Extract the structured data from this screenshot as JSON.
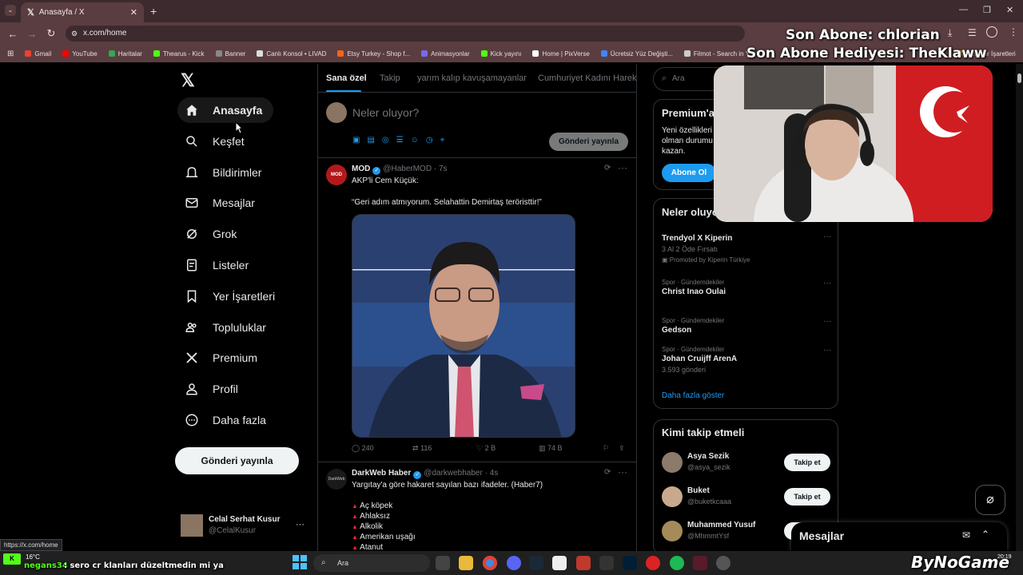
{
  "browser": {
    "tab_title": "Anasayfa / X",
    "new_tab": "+",
    "url": "x.com/home",
    "status_url": "https://x.com/home",
    "bookmarks": [
      "Gmail",
      "YouTube",
      "Haritalar",
      "Thearus - Kick",
      "Banner",
      "Canlı Konsol • LIVAD",
      "Etsy Turkey - Shop f...",
      "Animasyonlar",
      "Kick yayını",
      "Home | PixVerse",
      "Ücretsiz Yüz Değişti...",
      "Filmot - Search in Y...",
      "Tüm Yer İşaretleri"
    ],
    "bookmark_colors": [
      "#ea4335",
      "#ff0000",
      "#34a853",
      "#53fc18",
      "#888888",
      "#dddddd",
      "#f1641e",
      "#7b68ee",
      "#53fc18",
      "#ffffff",
      "#4285f4",
      "#cccccc",
      "#f4b400"
    ]
  },
  "sidebar": {
    "nav": [
      {
        "label": "Anasayfa",
        "icon": "home-icon"
      },
      {
        "label": "Keşfet",
        "icon": "search-icon"
      },
      {
        "label": "Bildirimler",
        "icon": "bell-icon"
      },
      {
        "label": "Mesajlar",
        "icon": "mail-icon"
      },
      {
        "label": "Grok",
        "icon": "grok-icon"
      },
      {
        "label": "Listeler",
        "icon": "list-icon"
      },
      {
        "label": "Yer İşaretleri",
        "icon": "bookmark-icon"
      },
      {
        "label": "Topluluklar",
        "icon": "communities-icon"
      },
      {
        "label": "Premium",
        "icon": "x-icon"
      },
      {
        "label": "Profil",
        "icon": "profile-icon"
      },
      {
        "label": "Daha fazla",
        "icon": "more-icon"
      }
    ],
    "post_button": "Gönderi yayınla",
    "account": {
      "name": "Celal Serhat Kusur",
      "handle": "@CelalKusur",
      "more": "···"
    }
  },
  "timeline": {
    "tabs": [
      "Sana özel",
      "Takip",
      "yarım kalıp kavuşamayanlar",
      "Cumhuriyet Kadını Hareketi"
    ],
    "compose_placeholder": "Neler oluyor?",
    "compose_button": "Gönderi yayınla",
    "tweets": [
      {
        "name": "MOD",
        "handle": "@HaberMOD",
        "time": "· 7s",
        "avatar_text": "MOD",
        "lines": [
          "AKP'li Cem Küçük:",
          "",
          "“Geri adım atmıyorum. Selahattin Demirtaş teröristtir!”"
        ],
        "replies": "240",
        "retweets": "116",
        "likes": "2 B",
        "views": "74 B"
      },
      {
        "name": "DarkWeb Haber",
        "handle": "@darkwebhaber",
        "time": "· 4s",
        "avatar_text": "DarkWeb",
        "lines": [
          "Yargıtay'a göre hakaret sayılan bazı ifadeler. (Haber7)"
        ],
        "list": [
          "Aç köpek",
          "Ahlaksız",
          "Alkolik",
          "Amerikan uşağı",
          "Atanut"
        ]
      }
    ]
  },
  "right": {
    "search_placeholder": "Ara",
    "premium": {
      "title": "Premium'a",
      "text": [
        "Yeni özellikleri",
        "olman durumu",
        "kazan."
      ],
      "button": "Abone Ol"
    },
    "trends": {
      "title": "Neler oluyor",
      "items": [
        {
          "meta": "",
          "name": "Trendyol X Kiperin",
          "sub": "3 Al 2 Öde Fırsatı",
          "extra": "Promoted by Kiperin Türkiye"
        },
        {
          "meta": "Spor · Gündemdekiler",
          "name": "Christ Inao Oulai",
          "sub": "",
          "extra": ""
        },
        {
          "meta": "Spor · Gündemdekiler",
          "name": "Gedson",
          "sub": "",
          "extra": ""
        },
        {
          "meta": "Spor · Gündemdekiler",
          "name": "Johan Cruijff ArenA",
          "sub": "3.593 gönderi",
          "extra": ""
        }
      ],
      "more": "Daha fazla göster"
    },
    "who_to_follow": {
      "title": "Kimi takip etmeli",
      "users": [
        {
          "name": "Asya Sezik",
          "handle": "@asya_sezik",
          "button": "Takip et"
        },
        {
          "name": "Buket",
          "handle": "@buketkcaaa",
          "button": "Takip et"
        },
        {
          "name": "Muhammed Yusuf",
          "handle": "@MhmmtYsf",
          "button": "Takip et"
        }
      ]
    },
    "messages_bar": "Mesajlar"
  },
  "stream": {
    "last_sub": "Son Abone: chlorian",
    "last_gift": "Son Abone Hediyesi: TheKlaww",
    "chat_user": "negans34",
    "chat_msg": ": sero cr klanları düzeltmedin mi ya",
    "brand": "ByNoGame"
  },
  "taskbar": {
    "weather": "16°C",
    "search": "Ara",
    "time": "20:19"
  }
}
